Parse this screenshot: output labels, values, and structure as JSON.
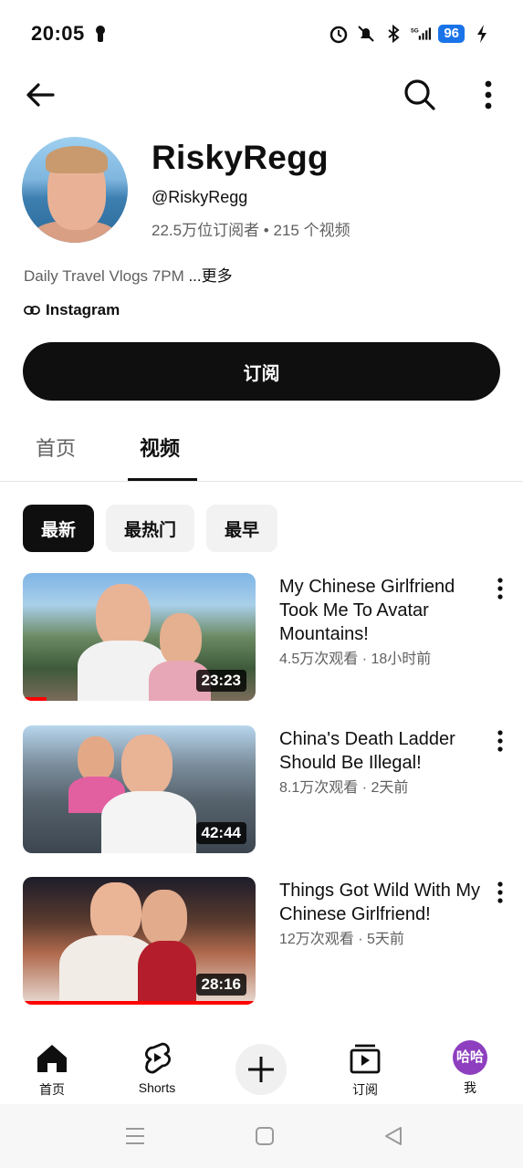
{
  "status_bar": {
    "time": "20:05",
    "signal_label": "5G",
    "battery": "96"
  },
  "channel": {
    "name": "RiskyRegg",
    "handle": "@RiskyRegg",
    "stats": "22.5万位订阅者 • 215 个视频",
    "description": "Daily Travel Vlogs 7PM ",
    "description_more": "...更多",
    "link_label": "Instagram",
    "subscribe_label": "订阅"
  },
  "tabs": [
    {
      "label": "首页"
    },
    {
      "label": "视频"
    }
  ],
  "chips": [
    {
      "label": "最新"
    },
    {
      "label": "最热门"
    },
    {
      "label": "最早"
    }
  ],
  "videos": [
    {
      "title": "My Chinese Girlfriend Took Me To Avatar Mountains!",
      "meta": "4.5万次观看 · 18小时前",
      "duration": "23:23",
      "watched": 0.1
    },
    {
      "title": "China's Death Ladder Should Be Illegal!",
      "meta": "8.1万次观看 · 2天前",
      "duration": "42:44",
      "watched": 0
    },
    {
      "title": "Things Got Wild With My Chinese Girlfriend!",
      "meta": "12万次观看 · 5天前",
      "duration": "28:16",
      "watched": 1.0
    }
  ],
  "bottom_nav": {
    "home": "首页",
    "shorts": "Shorts",
    "subscriptions": "订阅",
    "me": "我",
    "me_avatar_text": "哈哈"
  },
  "colors": {
    "accent": "#0f0f0f",
    "progress": "#ff0000",
    "battery": "#1a73e8",
    "me_avatar": "#8e3fbf"
  }
}
